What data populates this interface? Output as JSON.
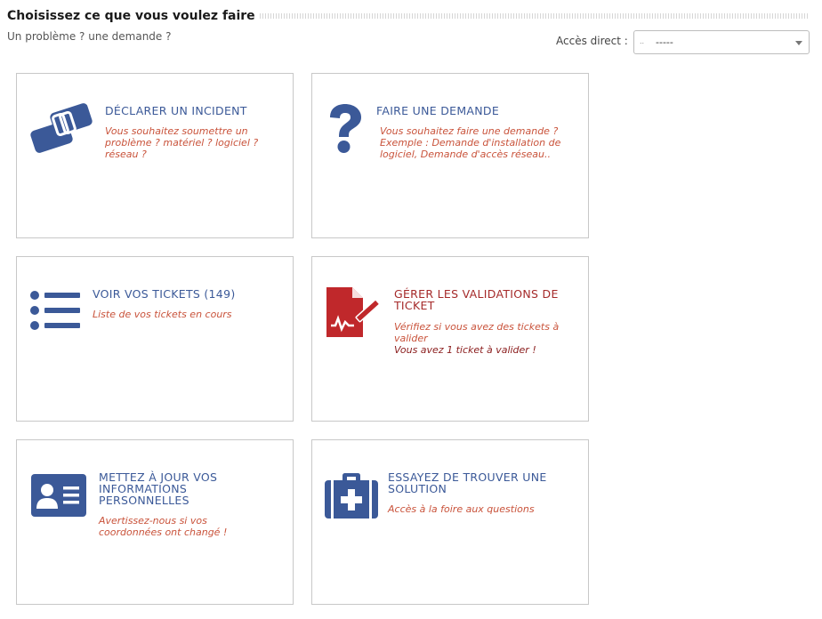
{
  "header": {
    "title": "Choisissez ce que vous voulez faire",
    "subtitle": "Un problème ? une demande ?"
  },
  "direct_access": {
    "label": "Accès direct :",
    "selected": "-----",
    "dots": ".."
  },
  "colors": {
    "accent_blue": "#3b5998",
    "description_red": "#c9533b",
    "validation_red": "#c0282b"
  },
  "cards": [
    {
      "icon": "handshake-icon",
      "title": "DÉCLARER UN INCIDENT",
      "description": "Vous souhaitez soumettre un problème ? matériel ? logiciel ? réseau ?"
    },
    {
      "icon": "question-mark-icon",
      "title": "FAIRE UNE DEMANDE",
      "description": "Vous souhaitez faire une demande ? Exemple : Demande d'installation de logiciel, Demande d'accès réseau.."
    },
    {
      "icon": "list-icon",
      "title": "VOIR VOS TICKETS (149)",
      "description": "Liste de vos tickets en cours"
    },
    {
      "icon": "signed-document-icon",
      "title": "GÉRER LES VALIDATIONS DE TICKET",
      "description": "Vérifiez si vous avez des tickets à valider",
      "extra": "Vous avez 1 ticket à valider !"
    },
    {
      "icon": "id-card-icon",
      "title": "METTEZ À JOUR VOS INFORMATIONS PERSONNELLES",
      "description": "Avertissez-nous si vos coordonnées ont changé !"
    },
    {
      "icon": "medkit-icon",
      "title": "ESSAYEZ DE TROUVER UNE SOLUTION",
      "description": "Accès à la foire aux questions"
    }
  ]
}
